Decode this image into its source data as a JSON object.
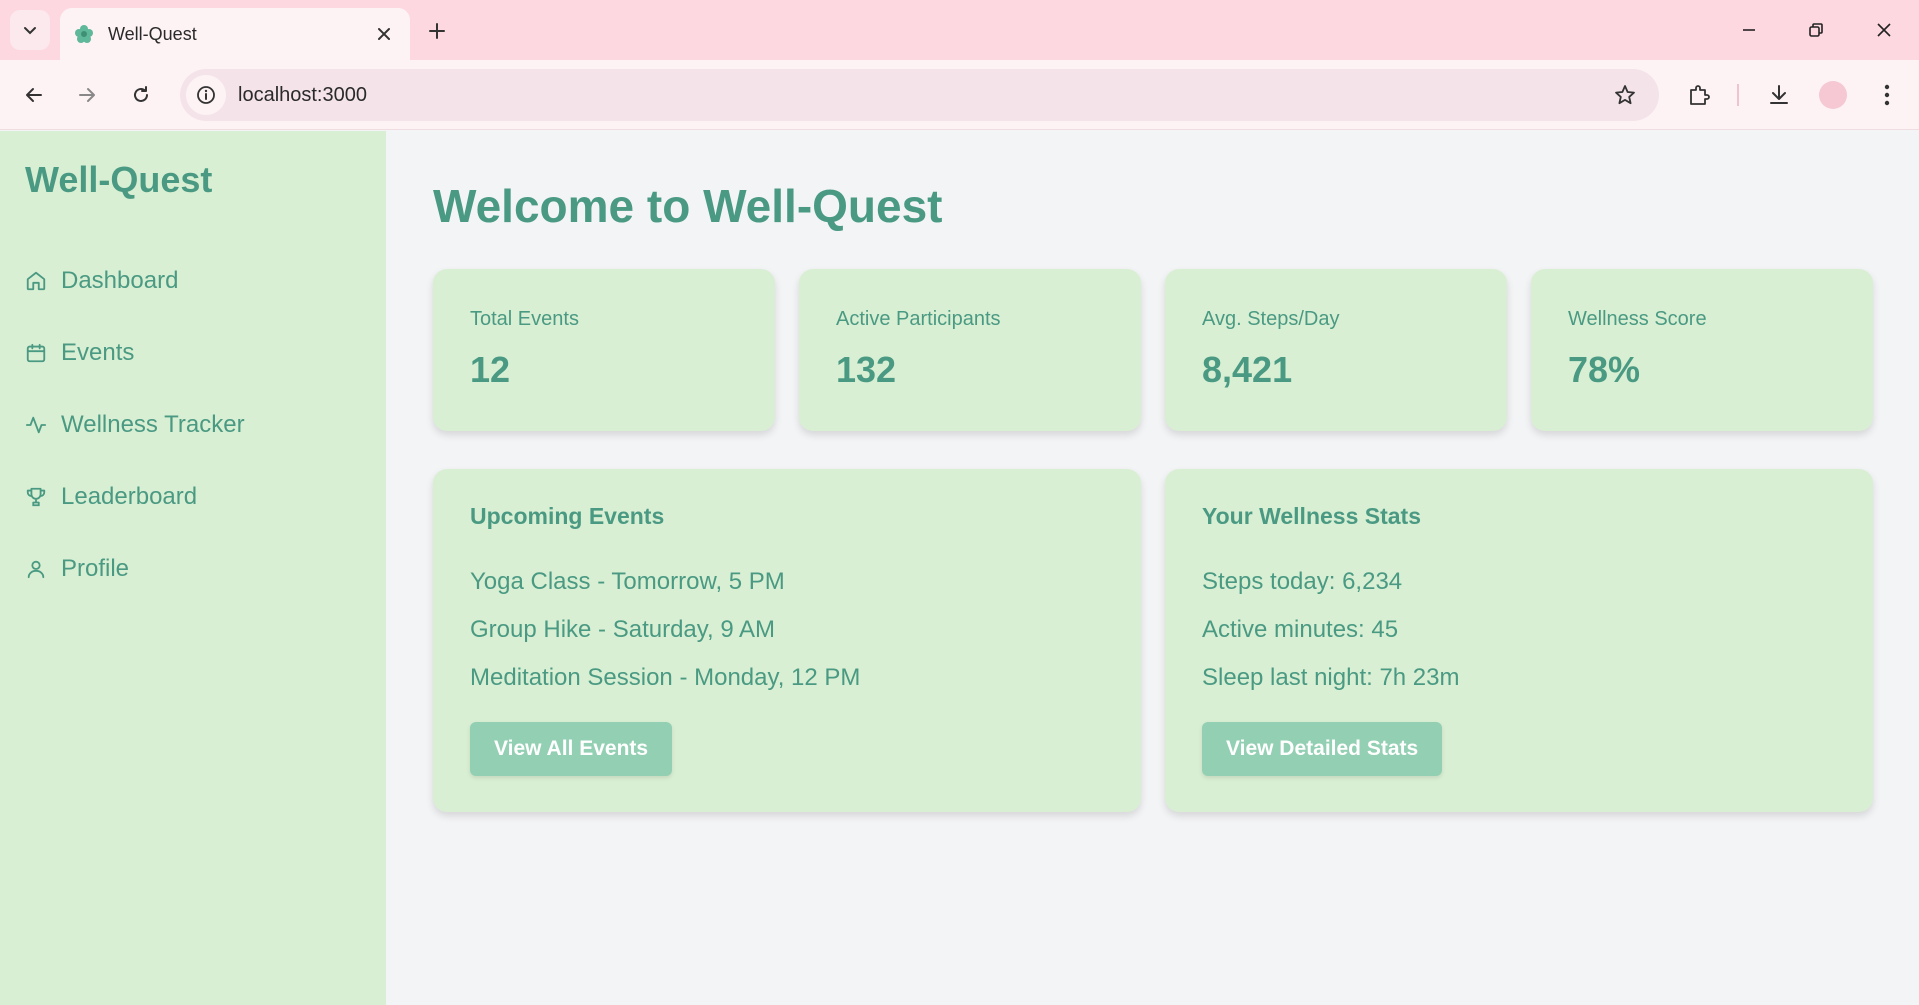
{
  "browser": {
    "tab_title": "Well-Quest",
    "url": "localhost:3000"
  },
  "sidebar": {
    "brand": "Well-Quest",
    "items": [
      {
        "label": "Dashboard",
        "icon": "home-icon"
      },
      {
        "label": "Events",
        "icon": "calendar-icon"
      },
      {
        "label": "Wellness Tracker",
        "icon": "activity-icon"
      },
      {
        "label": "Leaderboard",
        "icon": "trophy-icon"
      },
      {
        "label": "Profile",
        "icon": "user-icon"
      }
    ]
  },
  "main": {
    "title": "Welcome to Well-Quest",
    "stats": [
      {
        "label": "Total Events",
        "value": "12"
      },
      {
        "label": "Active Participants",
        "value": "132"
      },
      {
        "label": "Avg. Steps/Day",
        "value": "8,421"
      },
      {
        "label": "Wellness Score",
        "value": "78%"
      }
    ],
    "events_panel": {
      "title": "Upcoming Events",
      "items": [
        "Yoga Class - Tomorrow, 5 PM",
        "Group Hike - Saturday, 9 AM",
        "Meditation Session - Monday, 12 PM"
      ],
      "button": "View All Events"
    },
    "stats_panel": {
      "title": "Your Wellness Stats",
      "items": [
        "Steps today: 6,234",
        "Active minutes: 45",
        "Sleep last night: 7h 23m"
      ],
      "button": "View Detailed Stats"
    }
  },
  "colors": {
    "accent": "#4a9a83",
    "card_bg": "#d9efd3",
    "button_bg": "#93d0b3",
    "page_bg": "#f3f4f6",
    "chrome_bg": "#fdd8e0"
  }
}
